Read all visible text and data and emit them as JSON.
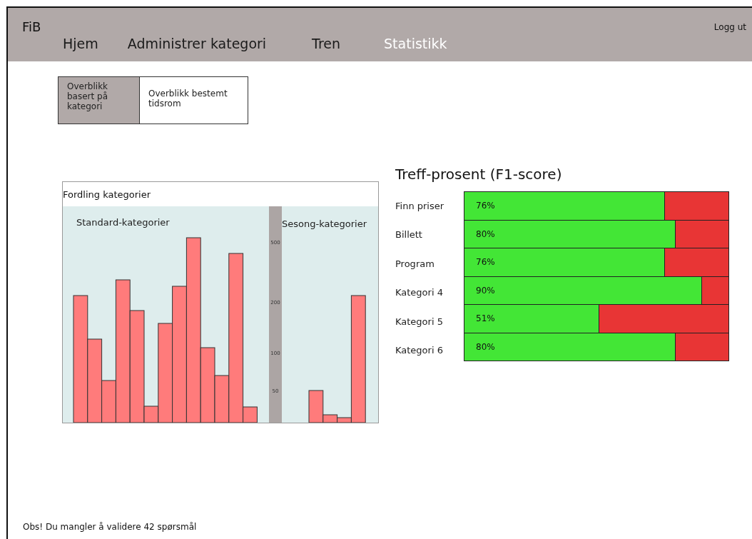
{
  "header": {
    "logo": "FiB",
    "logout": "Logg ut",
    "nav": [
      {
        "label": "Hjem",
        "selected": false
      },
      {
        "label": "Administrer kategori",
        "selected": false
      },
      {
        "label": "Tren",
        "selected": false
      },
      {
        "label": "Statistikk",
        "selected": true
      }
    ]
  },
  "view_toggle": [
    {
      "label": "Overblikk basert på kategori",
      "selected": true
    },
    {
      "label": "Overblikk bestemt tidsrom",
      "selected": false
    }
  ],
  "distribution": {
    "title": "Fordling kategorier",
    "kind": "picture",
    "panels": [
      {
        "label": "Standard-kategorier"
      },
      {
        "label": "Sesong-kategorier"
      }
    ],
    "axis_ticks": [
      "500",
      "200",
      "100",
      "50"
    ]
  },
  "f1": {
    "title": "Treff-prosent (F1-score)",
    "rows": [
      {
        "label": "Finn priser",
        "level": 0.76,
        "reading": "76%"
      },
      {
        "label": "Billett",
        "level": 0.8,
        "reading": "80%"
      },
      {
        "label": "Program",
        "level": 0.76,
        "reading": "76%"
      },
      {
        "label": "Kategori 4",
        "level": 0.9,
        "reading": "90%"
      },
      {
        "label": "Kategori 5",
        "level": 0.51,
        "reading": "51%"
      },
      {
        "label": "Kategori 6",
        "level": 0.8,
        "reading": "80%"
      }
    ]
  },
  "footer": {
    "notice": "Obs! Du mangler å validere 42 spørsmål"
  }
}
